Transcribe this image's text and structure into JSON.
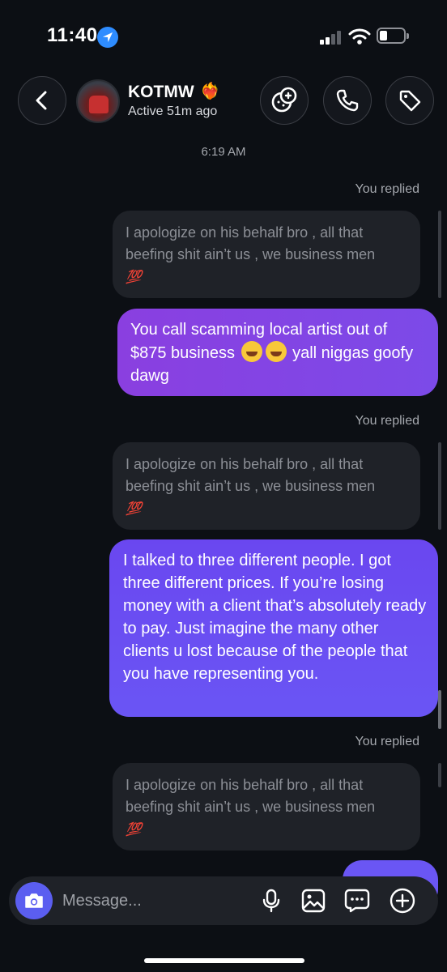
{
  "status_bar": {
    "time": "11:40"
  },
  "header": {
    "name": "KOTMW",
    "name_emoji": "❤️‍🔥",
    "status": "Active 51m ago"
  },
  "chat": {
    "timestamp": "6:19 AM",
    "replied_label": "You replied",
    "quoted_text": "I apologize on his behalf bro , all that beefing shit ain’t us , we business men",
    "quoted_emoji": "💯",
    "sent_1": {
      "text_a": "You call scamming local artist out of $875 business",
      "text_b": "yall niggas goofy dawg"
    },
    "sent_2": "I talked to three different people. I got three different prices. If you’re losing money with a client that’s absolutely ready to pay. Just imagine the many other clients u lost because of the people that you have representing you."
  },
  "composer": {
    "placeholder": "Message..."
  }
}
